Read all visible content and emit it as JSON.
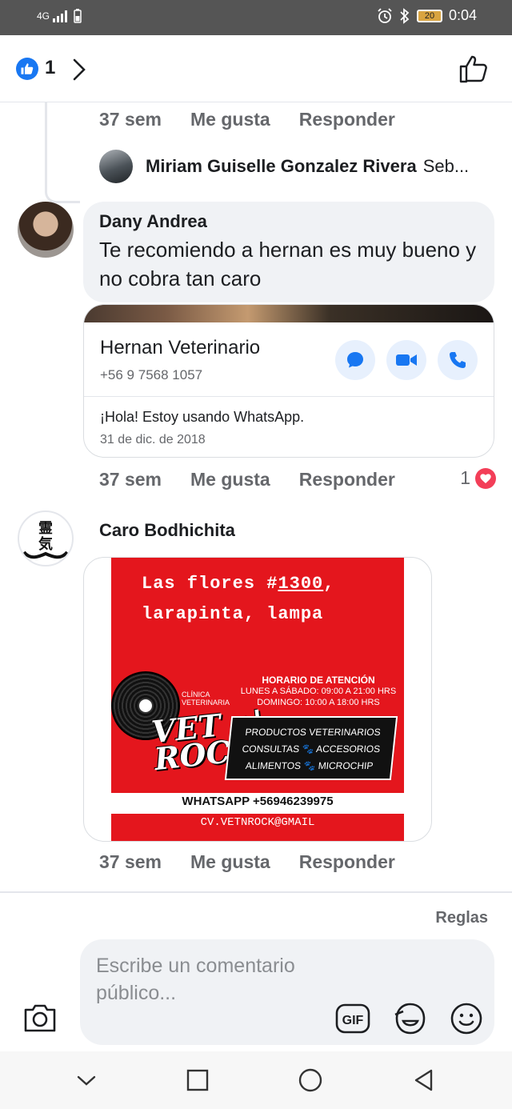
{
  "status_bar": {
    "network": "4G",
    "battery": "20",
    "time": "0:04"
  },
  "header": {
    "like_count": "1"
  },
  "comments": [
    {
      "time": "37 sem",
      "like_label": "Me gusta",
      "reply_label": "Responder"
    },
    {
      "author": "Dany Andrea",
      "text": "Te recomiendo a hernan es muy bueno y no cobra tan caro",
      "time": "37 sem",
      "like_label": "Me gusta",
      "reply_label": "Responder",
      "reaction_count": "1"
    },
    {
      "author": "Caro Bodhichita",
      "time": "37 sem",
      "like_label": "Me gusta",
      "reply_label": "Responder"
    }
  ],
  "reply_preview": {
    "author": "Miriam Guiselle Gonzalez Rivera",
    "snippet": "Seb..."
  },
  "whatsapp_card": {
    "title": "Hernan Veterinario",
    "phone": "+56 9 7568 1057",
    "status": "¡Hola! Estoy usando WhatsApp.",
    "date": "31 de dic. de 2018"
  },
  "flyer": {
    "address_line1_pre": "Las flores #",
    "address_number": "1300",
    "address_line1_post": ",",
    "address_line2": "larapinta, lampa",
    "clinic_label_1": "CLÍNICA",
    "clinic_label_2": "VETERINARIA",
    "brand_line1": "VET n'",
    "brand_line2": "ROCK",
    "hours_title": "HORARIO DE ATENCIÓN",
    "hours_weekday": "LUNES A SÁBADO: 09:00 A 21:00 HRS",
    "hours_sunday": "DOMINGO: 10:00 A 18:00 HRS",
    "service_1": "PRODUCTOS VETERINARIOS",
    "service_2": "CONSULTAS",
    "service_3": "ACCESORIOS",
    "service_4": "ALIMENTOS",
    "service_5": "MICROCHIP",
    "whatsapp": "WHATSAPP +56946239975",
    "email": "CV.VETNROCK@GMAIL"
  },
  "composer": {
    "rules_label": "Reglas",
    "placeholder": "Escribe un comentario público...",
    "gif_label": "GIF"
  },
  "colors": {
    "brand_blue": "#1877f2",
    "reaction_red": "#f33e58",
    "flyer_red": "#e4161d"
  }
}
